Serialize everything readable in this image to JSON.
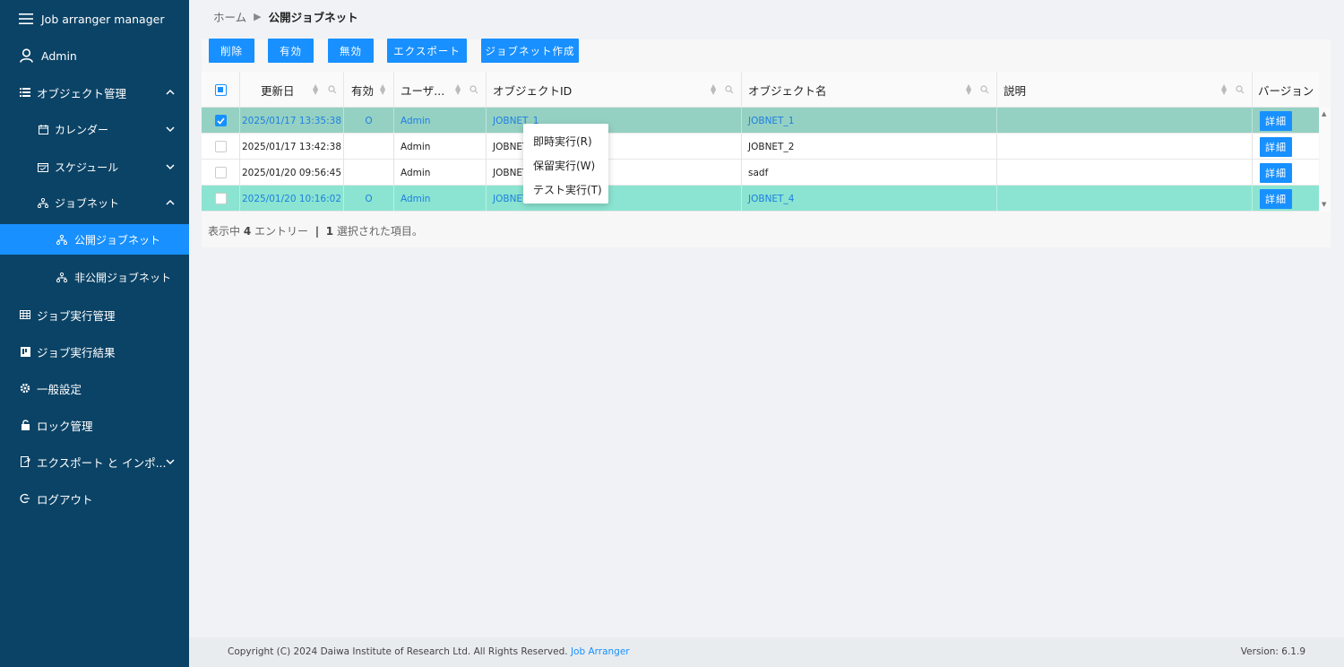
{
  "app": {
    "title": "Job arranger manager",
    "user": "Admin"
  },
  "sidebar": {
    "items": [
      {
        "label": "オブジェクト管理",
        "icon": "list-icon"
      },
      {
        "label": "カレンダー",
        "icon": "calendar-icon"
      },
      {
        "label": "スケジュール",
        "icon": "schedule-icon"
      },
      {
        "label": "ジョブネット",
        "icon": "network-icon"
      },
      {
        "label": "公開ジョブネット",
        "icon": "network-icon"
      },
      {
        "label": "非公開ジョブネット",
        "icon": "network-icon"
      },
      {
        "label": "ジョブ実行管理",
        "icon": "table-icon"
      },
      {
        "label": "ジョブ実行結果",
        "icon": "board-icon"
      },
      {
        "label": "一般設定",
        "icon": "gear-icon"
      },
      {
        "label": "ロック管理",
        "icon": "lock-icon"
      },
      {
        "label": "エクスポート と インポ...",
        "icon": "export-icon"
      },
      {
        "label": "ログアウト",
        "icon": "logout-icon"
      }
    ]
  },
  "breadcrumb": {
    "home": "ホーム",
    "current": "公開ジョブネット"
  },
  "toolbar": {
    "delete": "削除",
    "enable": "有効",
    "disable": "無効",
    "export": "エクスポート",
    "create": "ジョブネット作成"
  },
  "table": {
    "headers": {
      "updated": "更新日",
      "valid": "有効",
      "user": "ユーザ...",
      "object_id": "オブジェクトID",
      "object_name": "オブジェクト名",
      "description": "説明",
      "version": "バージョン"
    },
    "rows": [
      {
        "updated": "2025/01/17 13:35:38",
        "valid": "O",
        "user": "Admin",
        "object_id": "JOBNET_1",
        "object_name": "JOBNET_1",
        "description": "",
        "detail": "詳細",
        "checked": true
      },
      {
        "updated": "2025/01/17 13:42:38",
        "valid": "",
        "user": "Admin",
        "object_id": "JOBNET",
        "object_name": "JOBNET_2",
        "description": "",
        "detail": "詳細",
        "checked": false
      },
      {
        "updated": "2025/01/20 09:56:45",
        "valid": "",
        "user": "Admin",
        "object_id": "JOBNET",
        "object_name": "sadf",
        "description": "",
        "detail": "詳細",
        "checked": false
      },
      {
        "updated": "2025/01/20 10:16:02",
        "valid": "O",
        "user": "Admin",
        "object_id": "JOBNET",
        "object_name": "JOBNET_4",
        "description": "",
        "detail": "詳細",
        "checked": false
      }
    ]
  },
  "summary": {
    "prefix": "表示中",
    "count": "4",
    "entries": "エントリー",
    "sep": "|",
    "selected_count": "1",
    "selected_text": "選択された項目。"
  },
  "context_menu": {
    "items": [
      "即時実行(R)",
      "保留実行(W)",
      "テスト実行(T)"
    ]
  },
  "footer": {
    "copyright": "Copyright (C) 2024 Daiwa Institute of Research Ltd. All Rights Reserved.",
    "link": "Job Arranger",
    "version": "Version: 6.1.9"
  },
  "colors": {
    "sidebar": "#0b4366",
    "accent": "#1890ff",
    "row_selected": "#95d1c3",
    "row_highlight": "#8be4d1"
  }
}
